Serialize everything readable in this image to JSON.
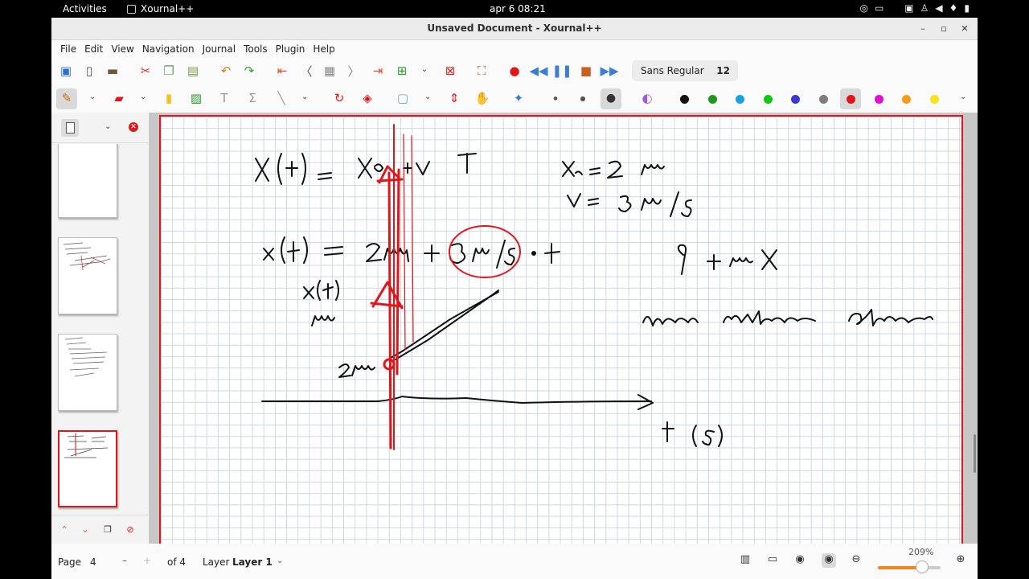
{
  "topbar": {
    "activities": "Activities",
    "app_name": "Xournal++",
    "clock": "apr 6  08:21",
    "tray_icons": [
      "help-icon",
      "display-icon",
      "screenshot-icon",
      "accessibility-icon",
      "volume-icon",
      "microphone-icon",
      "battery-icon"
    ]
  },
  "window": {
    "title": "Unsaved Document - Xournal++"
  },
  "menubar": {
    "items": [
      "File",
      "Edit",
      "View",
      "Navigation",
      "Journal",
      "Tools",
      "Plugin",
      "Help"
    ]
  },
  "toolbar": {
    "font_name": "Sans Regular",
    "font_size": "12",
    "colors": [
      "#111111",
      "#1a9a1a",
      "#15a3e0",
      "#11c811",
      "#3a3ad0",
      "#7d7d7d",
      "#e0161a",
      "#e010d0",
      "#f59b1a",
      "#f5e41a"
    ],
    "selected_color": "#e0161a"
  },
  "sidebar": {
    "pages": 4,
    "selected_page": 4
  },
  "canvas": {
    "handwriting": [
      "x(+) = x0 + v T",
      "x0 = 2 m",
      "v = 3 m/s",
      "x(t) = 2m + 3 m/s · t",
      "q + m X",
      "x(t)",
      "m",
      "2m",
      "t (s)"
    ]
  },
  "statusbar": {
    "page_label": "Page",
    "page_value": "4",
    "of_label": "of 4",
    "layer_label": "Layer",
    "layer_value": "Layer 1",
    "zoom": "209%",
    "zoom_fraction": 0.7
  }
}
